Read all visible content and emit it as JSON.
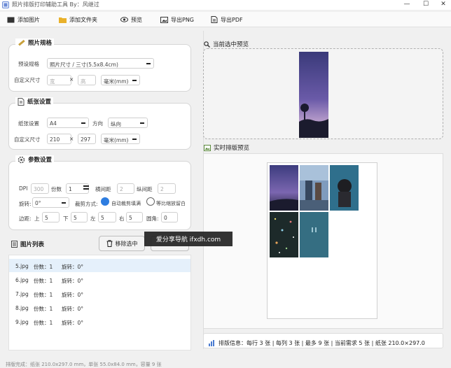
{
  "window": {
    "title": "照片排版打印辅助工具 By：风继过",
    "min": "—",
    "max": "☐",
    "close": "✕"
  },
  "toolbar": {
    "add_image": "添加图片",
    "add_folder": "添加文件夹",
    "preview": "预览",
    "export_png": "导出PNG",
    "export_pdf": "导出PDF"
  },
  "photo": {
    "title": "照片规格",
    "preset_label": "预设规格",
    "preset_value": "照片尺寸 / 三寸(5.5x8.4cm)",
    "custom_label": "自定义尺寸",
    "width_ph": "宽",
    "x": "×",
    "height_ph": "高",
    "unit": "毫米(mm)"
  },
  "paper": {
    "title": "纸张设置",
    "size_label": "纸张设置",
    "size_value": "A4",
    "dir_label": "方向",
    "dir_value": "纵向",
    "custom_label": "自定义尺寸",
    "w": "210",
    "x": "×",
    "h": "297",
    "unit": "毫米(mm)"
  },
  "params": {
    "title": "参数设置",
    "dpi_label": "DPI",
    "dpi": "300",
    "copies_label": "份数",
    "copies": "1",
    "hgap_label": "横间距",
    "hgap": "2",
    "vgap_label": "纵间距",
    "vgap": "2",
    "rotate_label": "旋转:",
    "rotate": "0°",
    "crop_label": "裁剪方式:",
    "crop_auto": "自动裁剪填满",
    "crop_fit": "等比缩放留白",
    "margin_label": "边距:",
    "top_label": "上",
    "top": "5",
    "bottom_label": "下",
    "bottom": "5",
    "left_label": "左",
    "left": "5",
    "right_label": "右",
    "right": "5",
    "radius_label": "圆角:",
    "radius": "0"
  },
  "list": {
    "title": "图片列表",
    "remove": "移除选中",
    "items": [
      {
        "name": "5.jpg",
        "copies": "份数：1",
        "rotate": "旋转：0°"
      },
      {
        "name": "6.jpg",
        "copies": "份数：1",
        "rotate": "旋转：0°"
      },
      {
        "name": "7.jpg",
        "copies": "份数：1",
        "rotate": "旋转：0°"
      },
      {
        "name": "8.jpg",
        "copies": "份数：1",
        "rotate": "旋转：0°"
      },
      {
        "name": "9.jpg",
        "copies": "份数：1",
        "rotate": "旋转：0°"
      }
    ]
  },
  "preview": {
    "title": "当前选中预览"
  },
  "layout": {
    "title": "实时排版预览",
    "info": "排版信息：每行 3 张 | 每列 3 张 | 最多 9 张 | 当前需求 5 张 | 纸张 210.0×297.0"
  },
  "status": "排版完成：纸张 210.0x297.0 mm，单张 55.0x84.0 mm，容量 9 张",
  "watermark": "爱分享导航 ifxdh.com",
  "colors": {
    "accent": "#2e7de0",
    "selected_row": "#e5f0fb"
  }
}
